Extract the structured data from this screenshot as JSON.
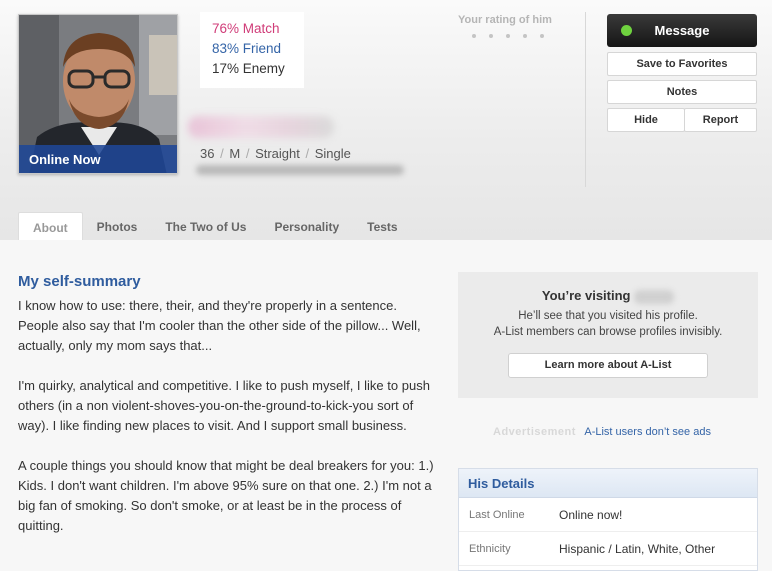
{
  "profile": {
    "online_label": "Online Now",
    "match": "76% Match",
    "friend": "83% Friend",
    "enemy": "17% Enemy",
    "age": "36",
    "gender": "M",
    "orientation": "Straight",
    "status": "Single"
  },
  "rating": {
    "label": "Your rating of him"
  },
  "actions": {
    "message": "Message",
    "save": "Save to Favorites",
    "notes": "Notes",
    "hide": "Hide",
    "report": "Report"
  },
  "tabs": [
    {
      "label": "About",
      "active": true
    },
    {
      "label": "Photos"
    },
    {
      "label": "The Two of Us"
    },
    {
      "label": "Personality"
    },
    {
      "label": "Tests"
    }
  ],
  "summary": {
    "title": "My self-summary",
    "paragraphs": [
      "I know how to use: there, their, and they're properly in a sentence. People also say that I'm cooler than the other side of the pillow... Well, actually, only my mom says that...",
      "I'm quirky, analytical and competitive. I like to push myself, I like to push others (in a non violent-shoves-you-on-the-ground-to-kick-you sort of way). I like finding new places to visit. And I support small business.",
      "A couple things you should know that might be deal breakers for you: 1.) Kids. I don't want children. I'm above 95% sure on that one. 2.) I'm not a big fan of smoking. So don't smoke, or at least be in the process of quitting."
    ]
  },
  "visiting": {
    "title": "You’re visiting",
    "line1": "He’ll see that you visited his profile.",
    "line2": "A-List members can browse profiles invisibly.",
    "button": "Learn more about A-List"
  },
  "ad": {
    "label": "Advertisement",
    "link": "A-List users don’t see ads"
  },
  "details": {
    "title": "His Details",
    "rows": [
      {
        "key": "Last Online",
        "value": "Online now!"
      },
      {
        "key": "Ethnicity",
        "value": "Hispanic / Latin, White, Other"
      }
    ]
  },
  "colors": {
    "match": "#d03c78",
    "friend": "#3464a7",
    "link": "#2f5c9e",
    "online_dot": "#6fd23f"
  }
}
